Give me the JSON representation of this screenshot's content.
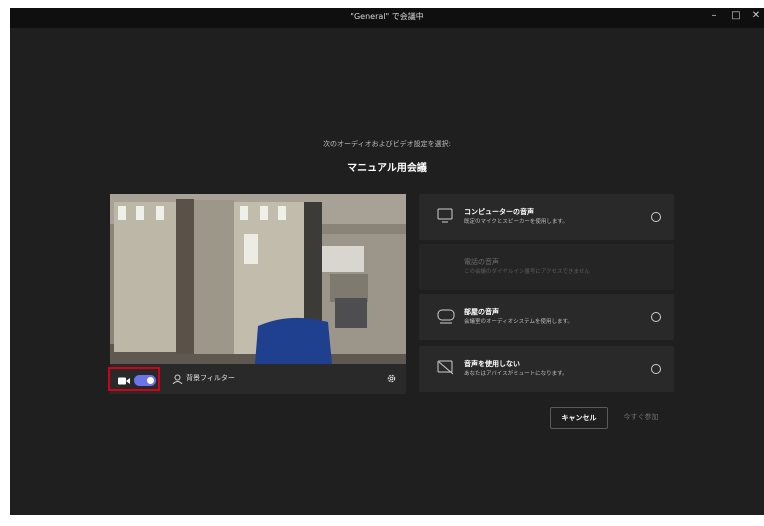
{
  "window": {
    "title": "\"General\" で会議中"
  },
  "prompt": "次のオーディオおよびビデオ設定を選択:",
  "meeting_title": "マニュアル用会議",
  "preview": {
    "background_filter_label": "背景フィルター",
    "camera_on": true
  },
  "audio_options": [
    {
      "title": "コンピューターの音声",
      "desc": "既定のマイクとスピーカーを使用します。",
      "icon": "computer-audio-icon",
      "enabled": true
    },
    {
      "title": "電話の音声",
      "desc": "この会議のダイヤルイン番号にアクセスできません",
      "icon": "",
      "enabled": false
    },
    {
      "title": "部屋の音声",
      "desc": "会議室のオーディオシステムを使用します。",
      "icon": "room-audio-icon",
      "enabled": true
    },
    {
      "title": "音声を使用しない",
      "desc": "あなたはアバイスがミュートになります。",
      "icon": "no-audio-icon",
      "enabled": true
    }
  ],
  "buttons": {
    "cancel": "キャンセル",
    "join": "今すぐ参加"
  },
  "colors": {
    "toggle_on": "#6b74e8",
    "highlight": "#d0021b",
    "background": "#1f1f1f"
  }
}
